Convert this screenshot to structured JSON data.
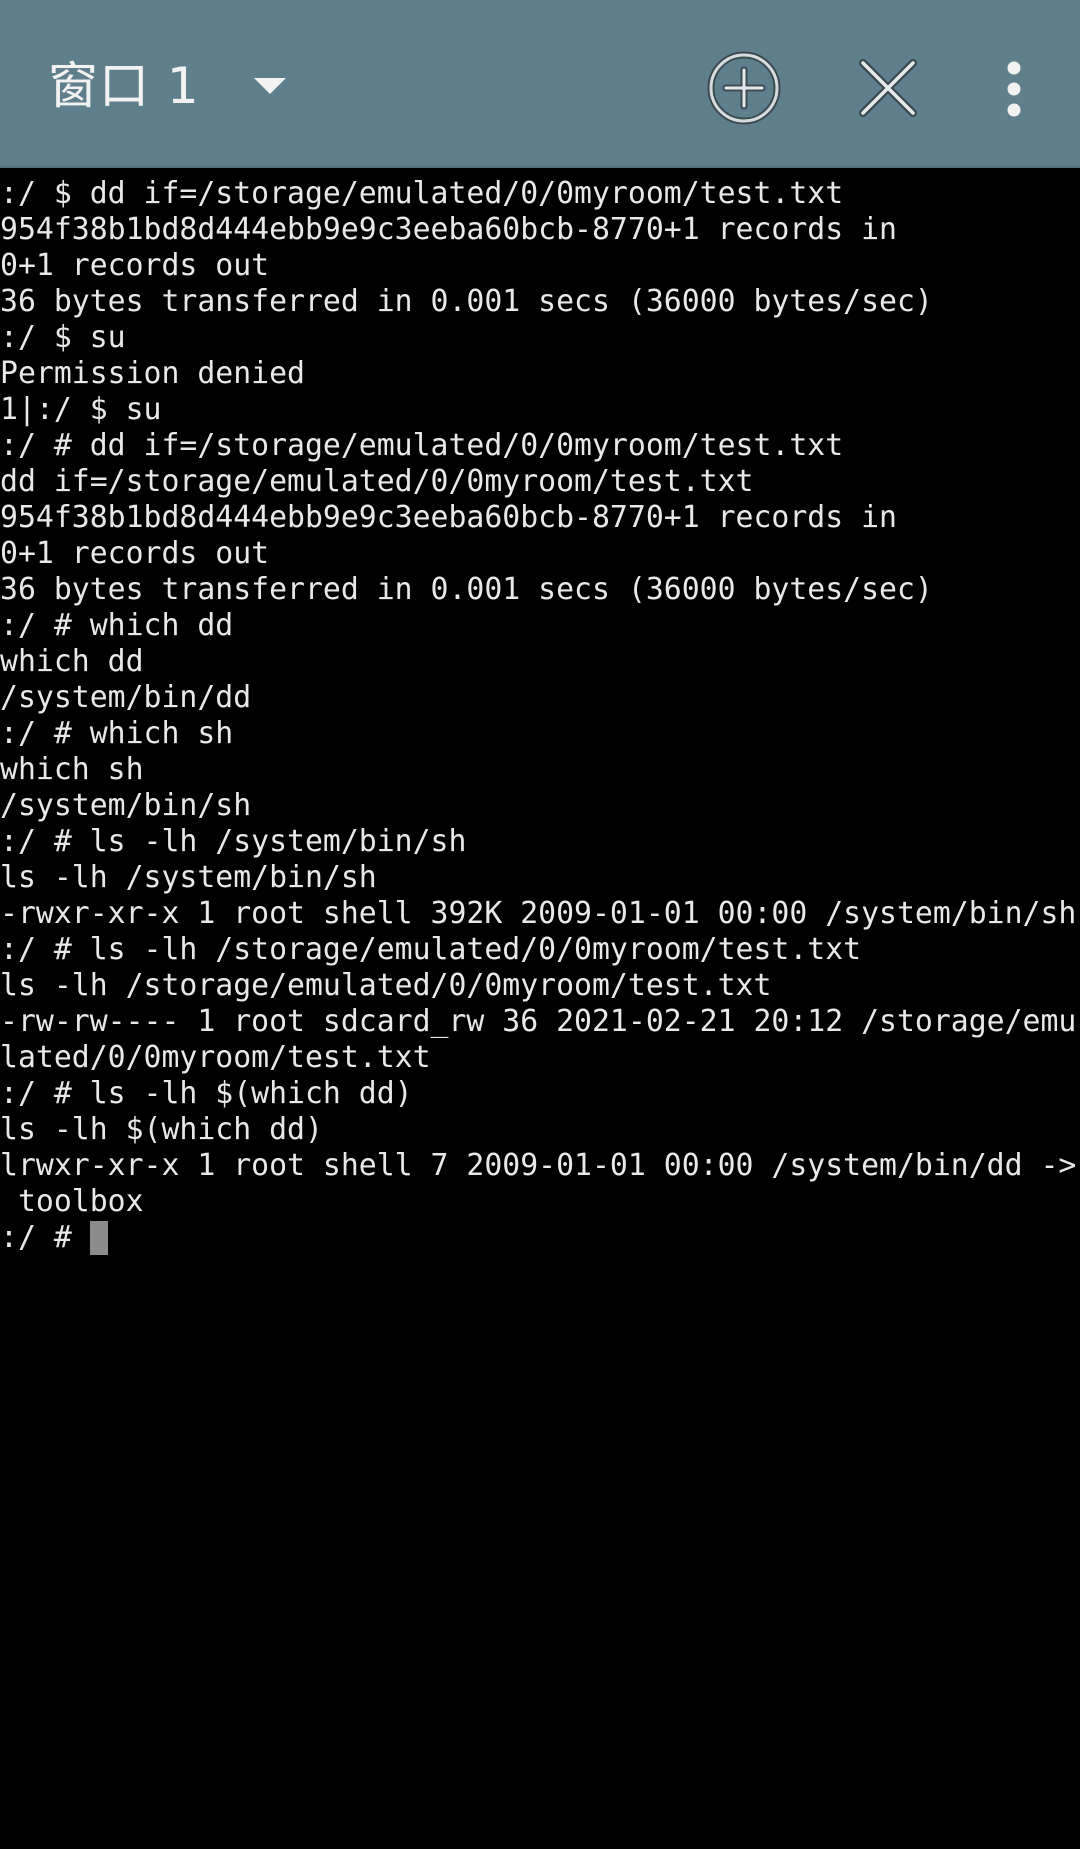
{
  "header": {
    "window_title": "窗口 1",
    "icons": {
      "dropdown": "caret-down-icon",
      "add": "add-circle-icon",
      "close": "close-icon",
      "more": "more-vert-icon"
    },
    "bar_color": "#5f7f8d"
  },
  "terminal": {
    "lines": [
      ":/ $ dd if=/storage/emulated/0/0myroom/test.txt",
      "954f38b1bd8d444ebb9e9c3eeba60bcb-8770+1 records in",
      "0+1 records out",
      "36 bytes transferred in 0.001 secs (36000 bytes/sec)",
      ":/ $ su",
      "Permission denied",
      "1|:/ $ su",
      ":/ # dd if=/storage/emulated/0/0myroom/test.txt",
      "dd if=/storage/emulated/0/0myroom/test.txt",
      "954f38b1bd8d444ebb9e9c3eeba60bcb-8770+1 records in",
      "0+1 records out",
      "36 bytes transferred in 0.001 secs (36000 bytes/sec)",
      ":/ # which dd",
      "which dd",
      "/system/bin/dd",
      ":/ # which sh",
      "which sh",
      "/system/bin/sh",
      ":/ # ls -lh /system/bin/sh",
      "ls -lh /system/bin/sh",
      "-rwxr-xr-x 1 root shell 392K 2009-01-01 00:00 /system/bin/sh",
      ":/ # ls -lh /storage/emulated/0/0myroom/test.txt",
      "ls -lh /storage/emulated/0/0myroom/test.txt",
      "-rw-rw---- 1 root sdcard_rw 36 2021-02-21 20:12 /storage/emu",
      "lated/0/0myroom/test.txt",
      ":/ # ls -lh $(which dd)",
      "ls -lh $(which dd)",
      "lrwxr-xr-x 1 root shell 7 2009-01-01 00:00 /system/bin/dd ->",
      " toolbox"
    ],
    "prompt": ":/ # ",
    "text_color": "#e8e8e8",
    "background": "#000000",
    "cursor_color": "#8c8c8c"
  }
}
